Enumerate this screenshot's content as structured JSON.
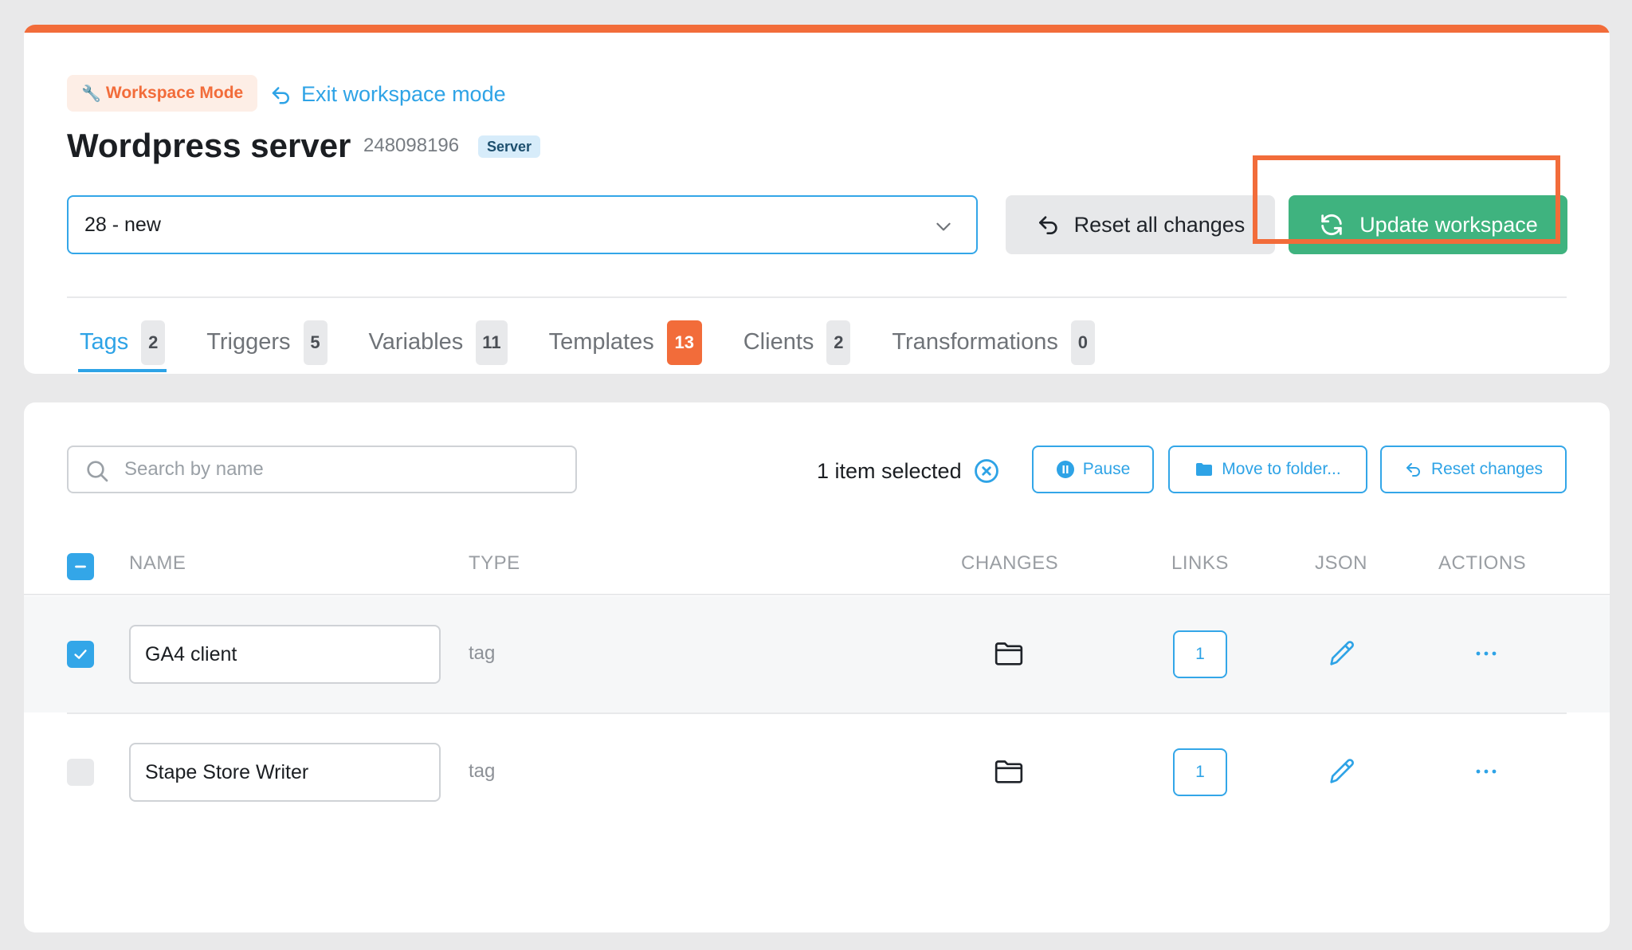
{
  "header": {
    "mode_badge": "Workspace Mode",
    "exit_link": "Exit workspace mode",
    "title": "Wordpress server",
    "container_id": "248098196",
    "type_badge": "Server",
    "version_select": {
      "value": "28 - new"
    },
    "reset_all_label": "Reset all changes",
    "update_label": "Update workspace"
  },
  "tabs": [
    {
      "label": "Tags",
      "count": "2",
      "active": true
    },
    {
      "label": "Triggers",
      "count": "5"
    },
    {
      "label": "Variables",
      "count": "11"
    },
    {
      "label": "Templates",
      "count": "13",
      "highlight": true
    },
    {
      "label": "Clients",
      "count": "2"
    },
    {
      "label": "Transformations",
      "count": "0"
    }
  ],
  "toolbar": {
    "search_placeholder": "Search by name",
    "selected_text": "1 item selected",
    "pause_label": "Pause",
    "move_label": "Move to folder...",
    "reset_label": "Reset changes"
  },
  "table": {
    "columns": [
      "NAME",
      "TYPE",
      "CHANGES",
      "LINKS",
      "JSON",
      "ACTIONS"
    ],
    "rows": [
      {
        "name": "GA4 client",
        "type": "tag",
        "links": "1",
        "checked": true
      },
      {
        "name": "Stape Store Writer",
        "type": "tag",
        "links": "1",
        "checked": false
      }
    ]
  },
  "colors": {
    "accent": "#f26c3a",
    "primary": "#2ea3e6",
    "success": "#3fb37f"
  },
  "icons": {
    "mode_badge": "wrench-icon",
    "exit": "undo-arrow-icon",
    "select": "chevron-down-icon",
    "reset_all": "undo-arrow-icon",
    "update": "refresh-icon",
    "search": "search-icon",
    "clear": "close-circle-icon",
    "pause": "pause-circle-icon",
    "move": "folder-icon",
    "reset": "undo-arrow-icon",
    "changes": "folder-outline-icon",
    "json": "pencil-icon",
    "actions": "ellipsis-icon"
  }
}
